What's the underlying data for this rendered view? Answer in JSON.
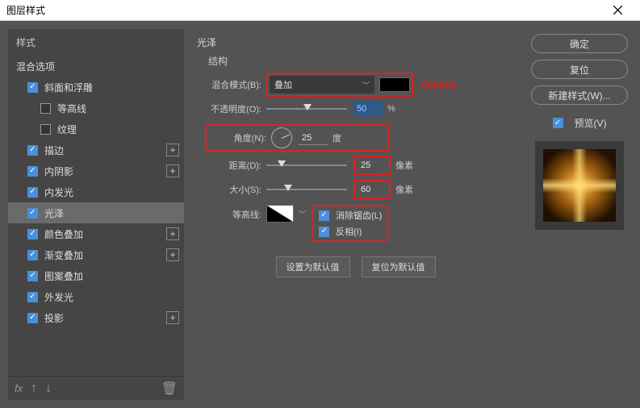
{
  "window": {
    "title": "图层样式"
  },
  "left": {
    "header": "样式",
    "blending": "混合选项",
    "items": [
      {
        "label": "斜面和浮雕",
        "checked": true,
        "plus": false,
        "indent": 0
      },
      {
        "label": "等高线",
        "checked": false,
        "plus": false,
        "indent": 1
      },
      {
        "label": "纹理",
        "checked": false,
        "plus": false,
        "indent": 1
      },
      {
        "label": "描边",
        "checked": true,
        "plus": true,
        "indent": 0
      },
      {
        "label": "内阴影",
        "checked": true,
        "plus": true,
        "indent": 0
      },
      {
        "label": "内发光",
        "checked": true,
        "plus": false,
        "indent": 0
      },
      {
        "label": "光泽",
        "checked": true,
        "plus": false,
        "indent": 0,
        "selected": true
      },
      {
        "label": "颜色叠加",
        "checked": true,
        "plus": true,
        "indent": 0
      },
      {
        "label": "渐变叠加",
        "checked": true,
        "plus": true,
        "indent": 0
      },
      {
        "label": "图案叠加",
        "checked": true,
        "plus": false,
        "indent": 0
      },
      {
        "label": "外发光",
        "checked": true,
        "plus": false,
        "indent": 0
      },
      {
        "label": "投影",
        "checked": true,
        "plus": true,
        "indent": 0
      }
    ]
  },
  "center": {
    "title": "光泽",
    "subtitle": "结构",
    "blend_mode": {
      "label": "混合模式(B):",
      "value": "叠加",
      "annot": "000000"
    },
    "opacity": {
      "label": "不透明度(O):",
      "value": "50",
      "unit": "%"
    },
    "angle": {
      "label": "角度(N):",
      "value": "25",
      "unit": "度"
    },
    "distance": {
      "label": "距离(D):",
      "value": "25",
      "unit": "像素"
    },
    "size": {
      "label": "大小(S):",
      "value": "60",
      "unit": "像素"
    },
    "contour_label": "等高线:",
    "antialias": {
      "label": "消除锯齿(L)",
      "checked": true
    },
    "invert": {
      "label": "反相(I)",
      "checked": true
    },
    "btn_default": "设置为默认值",
    "btn_reset": "复位为默认值"
  },
  "right": {
    "ok": "确定",
    "cancel": "复位",
    "newstyle": "新建样式(W)...",
    "preview_label": "预览(V)"
  }
}
